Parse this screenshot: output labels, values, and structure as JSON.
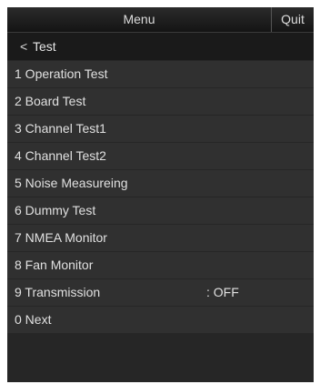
{
  "header": {
    "title": "Menu",
    "quit_label": "Quit"
  },
  "back": {
    "icon": "chevron-left-icon",
    "glyph": "<",
    "label": "Test"
  },
  "menu": {
    "items": [
      {
        "label": "1 Operation Test",
        "value": ""
      },
      {
        "label": "2 Board Test",
        "value": ""
      },
      {
        "label": "3 Channel Test1",
        "value": ""
      },
      {
        "label": "4 Channel Test2",
        "value": ""
      },
      {
        "label": "5 Noise Measureing",
        "value": ""
      },
      {
        "label": "6 Dummy Test",
        "value": ""
      },
      {
        "label": "7 NMEA Monitor",
        "value": ""
      },
      {
        "label": "8 Fan Monitor",
        "value": ""
      },
      {
        "label": "9 Transmission",
        "value": ": OFF"
      },
      {
        "label": "0 Next",
        "value": ""
      }
    ]
  },
  "colors": {
    "panel_background": "#262626",
    "row_background": "#303030",
    "text": "#e0e0e0"
  }
}
